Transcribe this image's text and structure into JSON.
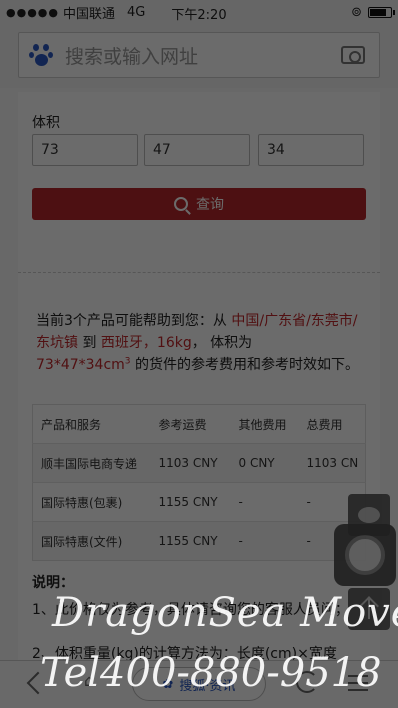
{
  "status_bar": {
    "carrier": "中国联通",
    "network": "4G",
    "time": "下午2:20",
    "signal": "●●●●●",
    "battery_level": 0.85
  },
  "search": {
    "placeholder": "搜索或输入网址"
  },
  "form": {
    "volume_label": "体积",
    "length": "73",
    "width": "47",
    "height": "34",
    "query_button": "查询"
  },
  "result": {
    "prefix": "当前3个产品可能帮助到您：从 ",
    "origin": "中国/广东省/东莞市/东坑镇",
    "to": " 到 ",
    "destination": "西班牙",
    "comma": "，",
    "weight": "16kg",
    "volume_text": "，  体积为",
    "dims": "73*47*34cm",
    "dims_sup": "3",
    "suffix": " 的货件的参考费用和参考时效如下。"
  },
  "table": {
    "headers": [
      "产品和服务",
      "参考运费",
      "其他费用",
      "总费用"
    ],
    "rows": [
      [
        "顺丰国际电商专递",
        "1103 CNY",
        "0 CNY",
        "1103 CN"
      ],
      [
        "国际特惠(包裹)",
        "1155 CNY",
        "-",
        "-"
      ],
      [
        "国际特惠(文件)",
        "1155 CNY",
        "-",
        "-"
      ]
    ]
  },
  "notes": {
    "title": "说明：",
    "line1": "1、此价格仅为参考，具体请咨询您的客服人员问；",
    "line2": "2、体积重量(kg)的计算方法为：长度(cm)×宽度"
  },
  "bottom_nav": {
    "center_label": "搜狐·资讯"
  },
  "watermark": {
    "line1": "DragonSea Moves",
    "line2": "Tel400-880-9518"
  }
}
